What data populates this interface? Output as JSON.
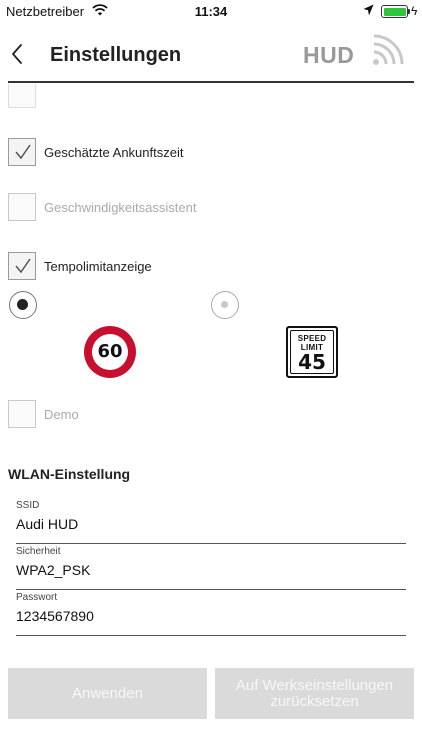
{
  "status_bar": {
    "carrier": "Netzbetreiber",
    "time": "11:34",
    "battery_level": 1.0,
    "icons": [
      "wifi-icon",
      "location-arrow-icon",
      "battery-icon",
      "charging-bolt-icon"
    ]
  },
  "header": {
    "title": "Einstellungen",
    "hud_label": "HUD",
    "back_icon": "chevron-left-icon",
    "signal_icon": "wireless-signal-icon"
  },
  "options": [
    {
      "label": "Geschätzte Ankunftszeit",
      "checked": true,
      "enabled": true
    },
    {
      "label": "Geschwindigkeitsassistent",
      "checked": false,
      "enabled": false
    },
    {
      "label": "Tempolimitanzeige",
      "checked": true,
      "enabled": true
    }
  ],
  "speed_limit_style": {
    "options": [
      {
        "id": "eu",
        "sign_text": "60",
        "selected": true
      },
      {
        "id": "us",
        "sign_text_top": "SPEED",
        "sign_text_mid": "LIMIT",
        "sign_text": "45",
        "selected": false
      }
    ]
  },
  "demo": {
    "label": "Demo",
    "checked": false,
    "enabled": false
  },
  "wlan": {
    "section_title": "WLAN-Einstellung",
    "fields": [
      {
        "label": "SSID",
        "value": "Audi HUD"
      },
      {
        "label": "Sicherheit",
        "value": "WPA2_PSK"
      },
      {
        "label": "Passwort",
        "value": "1234567890"
      }
    ]
  },
  "buttons": {
    "apply": "Anwenden",
    "reset": "Auf Werkseinstellungen zurücksetzen"
  },
  "colors": {
    "sign_red": "#c8102e",
    "battery_green": "#2fc53f",
    "button_bg": "#dadada",
    "hud_gray": "#999999"
  }
}
